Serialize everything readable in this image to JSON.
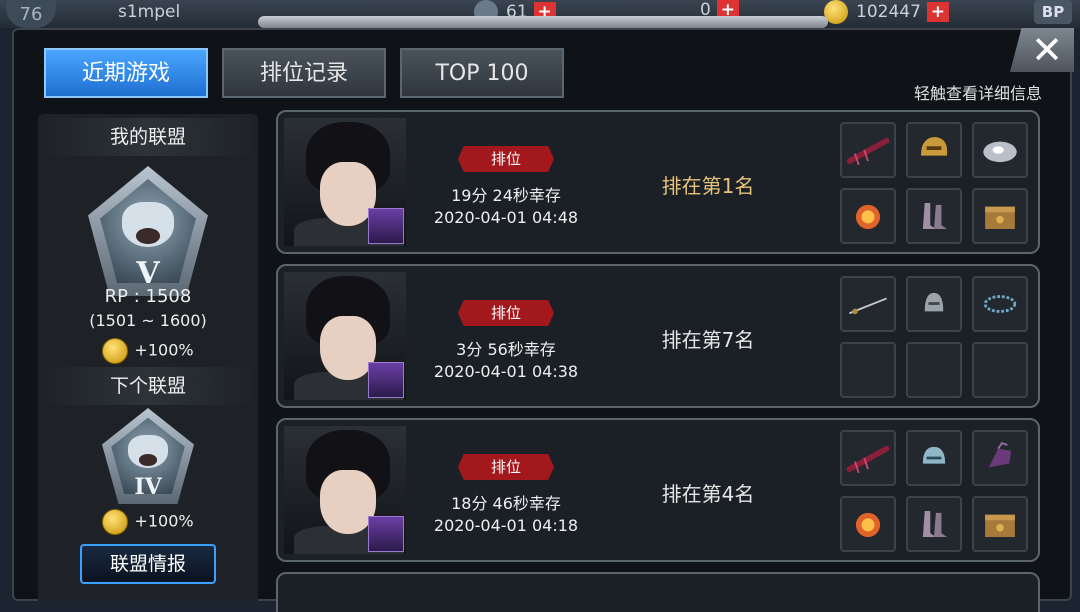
{
  "topbar": {
    "level": "76",
    "username": "s1mpel",
    "resource_1": "61",
    "resource_2": "0",
    "gold": "102447",
    "bp_label": "BP"
  },
  "tabs": [
    {
      "label": "近期游戏",
      "active": true
    },
    {
      "label": "排位记录",
      "active": false
    },
    {
      "label": "TOP 100",
      "active": false
    }
  ],
  "hint": "轻触查看详细信息",
  "league": {
    "my_title": "我的联盟",
    "my_tier": "V",
    "rp": "RP : 1508",
    "range": "(1501 ~ 1600)",
    "my_bonus": "+100%",
    "next_title": "下个联盟",
    "next_tier": "IV",
    "next_bonus": "+100%",
    "button": "联盟情报"
  },
  "matches": [
    {
      "mode": "排位",
      "survival": "19分 24秒幸存",
      "date": "2020-04-01 04:48",
      "rank": "排在第1名",
      "items": [
        "crossbow-icon",
        "helmet-icon",
        "disc-icon",
        "fire-orb-icon",
        "boots-icon",
        "crate-icon"
      ]
    },
    {
      "mode": "排位",
      "survival": "3分 56秒幸存",
      "date": "2020-04-01 04:38",
      "rank": "排在第7名",
      "items": [
        "rapier-icon",
        "helmet-icon",
        "bracelet-icon",
        "empty",
        "empty",
        "empty"
      ]
    },
    {
      "mode": "排位",
      "survival": "18分 46秒幸存",
      "date": "2020-04-01 04:18",
      "rank": "排在第4名",
      "items": [
        "crossbow-icon",
        "helmet-icon",
        "gauntlet-icon",
        "fire-orb-icon",
        "boots-icon",
        "crate-icon"
      ]
    }
  ],
  "colors": {
    "accent_blue": "#2f8ae8",
    "mode_red": "#a3181c",
    "first_place_gold": "#e6c27a"
  }
}
